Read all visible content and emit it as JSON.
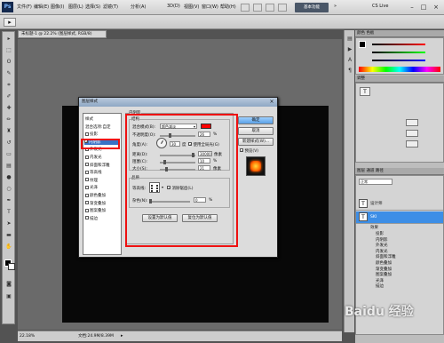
{
  "menubar": {
    "logo": "Ps",
    "menus": [
      "文件(F)",
      "编辑(E)",
      "图像(I)",
      "图层(L)",
      "选择(S)",
      "滤镜(T)",
      "分析(A)",
      "3D(D)",
      "视图(V)",
      "窗口(W)",
      "帮助(H)"
    ],
    "zoom": "22.2%",
    "workspace_button": "基本功能",
    "cs_live": "CS Live"
  },
  "document": {
    "tab_title": "未标题-1 @ 22.2% (图层样式, RGB/8)",
    "status_zoom": "22.18%",
    "status_doc": "文档:24.9M/8.39M"
  },
  "dialog": {
    "title": "图层样式",
    "style_list": [
      {
        "label": "样式",
        "checkbox": false,
        "checked": false
      },
      {
        "label": "混合选项:自定",
        "checkbox": false,
        "checked": false
      },
      {
        "label": "投影",
        "checkbox": true,
        "checked": false
      },
      {
        "label": "内阴影",
        "checkbox": true,
        "checked": true,
        "selected": true
      },
      {
        "label": "外发光",
        "checkbox": true,
        "checked": false
      },
      {
        "label": "内发光",
        "checkbox": true,
        "checked": false
      },
      {
        "label": "斜面和浮雕",
        "checkbox": true,
        "checked": false
      },
      {
        "label": "等高线",
        "checkbox": true,
        "checked": false
      },
      {
        "label": "纹理",
        "checkbox": true,
        "checked": false
      },
      {
        "label": "光泽",
        "checkbox": true,
        "checked": false
      },
      {
        "label": "颜色叠加",
        "checkbox": true,
        "checked": false
      },
      {
        "label": "渐变叠加",
        "checkbox": true,
        "checked": false
      },
      {
        "label": "图案叠加",
        "checkbox": true,
        "checked": false
      },
      {
        "label": "描边",
        "checkbox": true,
        "checked": false
      }
    ],
    "section_title": "内阴影",
    "structure_title": "结构",
    "blend_mode_label": "混合模式(B):",
    "blend_mode_value": "颜色减淡",
    "shadow_color": "#ff0000",
    "opacity_label": "不透明度(O):",
    "opacity_value": "26",
    "angle_label": "角度(A):",
    "angle_value": "30",
    "angle_unit": "度",
    "global_light_label": "使用全局光(G)",
    "global_light_checked": true,
    "distance_label": "距离(D):",
    "distance_value": "30000",
    "choke_label": "阻塞(C):",
    "choke_value": "10",
    "size_label": "大小(S):",
    "size_value": "21",
    "px_unit": "像素",
    "percent_unit": "%",
    "quality_title": "品质",
    "contour_label": "等高线:",
    "antialias_label": "消除锯齿(L)",
    "antialias_checked": true,
    "noise_label": "杂色(N):",
    "noise_value": "0",
    "set_default_btn": "设置为默认值",
    "reset_default_btn": "复位为默认值",
    "ok_btn": "确定",
    "cancel_btn": "取消",
    "new_style_btn": "新建样式(W)...",
    "preview_label": "预览(V)",
    "preview_checked": true
  },
  "panels": {
    "color_tab": "颜色",
    "swatches_tab": "色板",
    "adjust_tab": "调整",
    "layers_tab": "图层",
    "channels_tab": "通道",
    "paths_tab": "路径",
    "blend_mode": "正常",
    "layers": [
      {
        "name": "设计师",
        "type": "text",
        "selected": false
      },
      {
        "name": "SKI",
        "type": "text",
        "selected": true
      }
    ],
    "effects_label": "效果",
    "effects": [
      "投影",
      "内阴影",
      "外发光",
      "内发光",
      "斜面和浮雕",
      "颜色叠加",
      "渐变叠加",
      "图案叠加",
      "光泽",
      "描边"
    ],
    "watermark": "Baidu 经验"
  }
}
